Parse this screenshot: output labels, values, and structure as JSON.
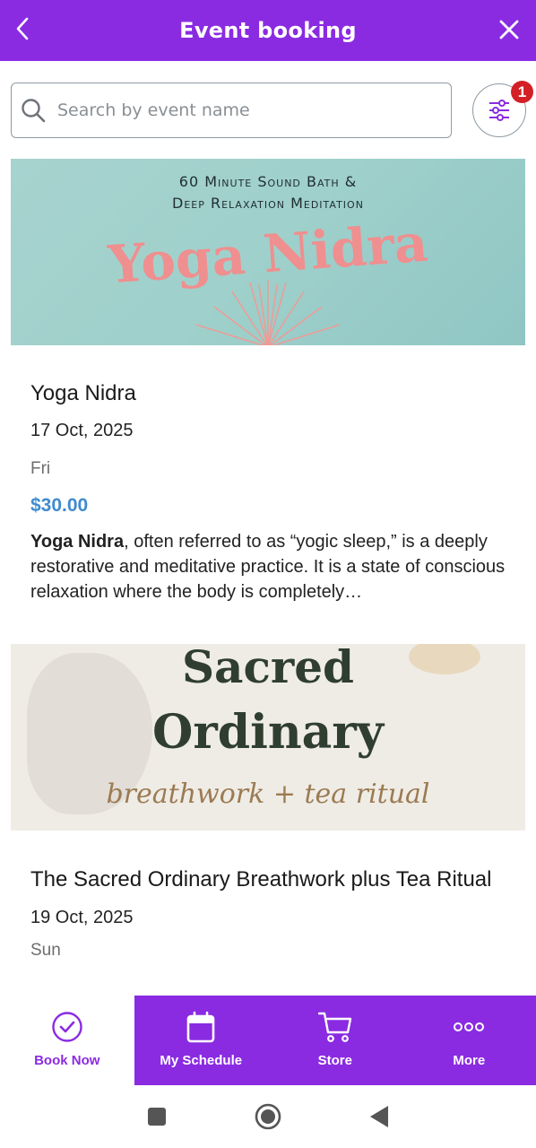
{
  "header": {
    "title": "Event booking",
    "back_icon": "chevron-left-icon",
    "close_icon": "close-icon"
  },
  "search": {
    "placeholder": "Search by event name",
    "value": ""
  },
  "filter": {
    "icon": "sliders-icon",
    "badge_count": "1"
  },
  "events": [
    {
      "image_lines": [
        "60 Minute Sound Bath &",
        "Deep Relaxation Meditation"
      ],
      "image_title": "Yoga Nidra",
      "name": "Yoga Nidra",
      "date": "17 Oct, 2025",
      "weekday": "Fri",
      "price": "$30.00",
      "desc_bold": "Yoga Nidra",
      "desc_rest": ", often referred to as “yogic sleep,” is a deeply restorative and meditative practice. It is a state of conscious relaxation where the body is completely…"
    },
    {
      "image_lines": [
        "Sacred",
        "Ordinary",
        "breathwork + tea ritual"
      ],
      "name": "The Sacred Ordinary Breathwork plus Tea Ritual",
      "date": "19 Oct, 2025",
      "weekday": "Sun"
    }
  ],
  "nav": [
    {
      "label": "Book Now",
      "icon": "check-circle-icon",
      "active": true
    },
    {
      "label": "My Schedule",
      "icon": "calendar-icon",
      "active": false
    },
    {
      "label": "Store",
      "icon": "cart-icon",
      "active": false
    },
    {
      "label": "More",
      "icon": "more-dots-icon",
      "active": false
    }
  ],
  "colors": {
    "brand": "#8a2be2",
    "price": "#3f8bd0",
    "badge": "#d32027"
  }
}
